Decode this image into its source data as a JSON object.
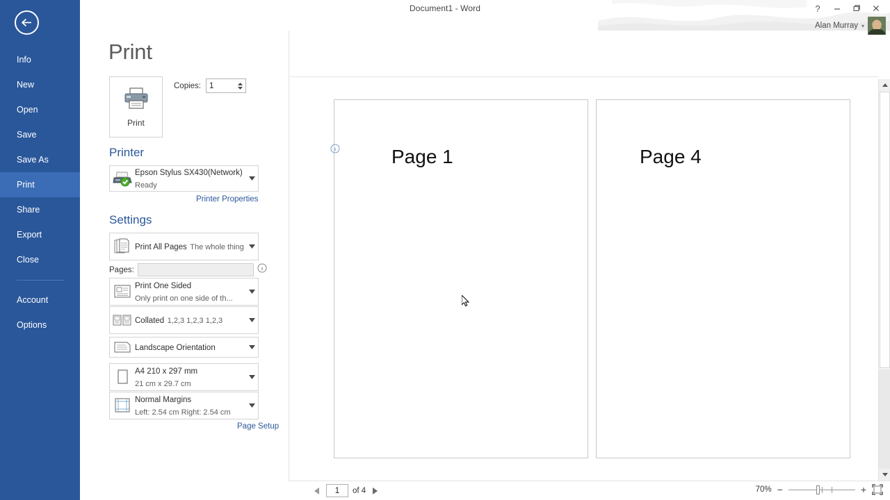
{
  "titlebar": {
    "document_title": "Document1 - Word",
    "help_icon": "question-mark-icon",
    "minimize_icon": "minimize-icon",
    "restore_icon": "restore-window-icon",
    "close_icon": "close-icon",
    "account_name": "Alan Murray",
    "account_caret": "▾"
  },
  "sidebar": {
    "back_icon": "back-arrow-icon",
    "items": [
      {
        "label": "Info",
        "name": "info",
        "active": false
      },
      {
        "label": "New",
        "name": "new",
        "active": false
      },
      {
        "label": "Open",
        "name": "open",
        "active": false
      },
      {
        "label": "Save",
        "name": "save",
        "active": false
      },
      {
        "label": "Save As",
        "name": "save-as",
        "active": false
      },
      {
        "label": "Print",
        "name": "print",
        "active": true
      },
      {
        "label": "Share",
        "name": "share",
        "active": false
      },
      {
        "label": "Export",
        "name": "export",
        "active": false
      },
      {
        "label": "Close",
        "name": "close",
        "active": false
      }
    ],
    "footer_items": [
      {
        "label": "Account",
        "name": "account"
      },
      {
        "label": "Options",
        "name": "options"
      }
    ]
  },
  "print_panel": {
    "heading": "Print",
    "print_button_label": "Print",
    "print_button_icon": "printer-icon",
    "copies_label": "Copies:",
    "copies_value": "1",
    "printer_section_title": "Printer",
    "printer_info_icon": "info-icon",
    "printer_name": "Epson Stylus SX430(Network)",
    "printer_status": "Ready",
    "printer_icon": "printer-ready-icon",
    "printer_properties_link": "Printer Properties",
    "settings_section_title": "Settings",
    "pages_label": "Pages:",
    "pages_value": "",
    "pages_info_icon": "info-icon",
    "page_setup_link": "Page Setup",
    "settings": [
      {
        "name": "print-range",
        "icon": "stacked-pages-icon",
        "primary": "Print All Pages",
        "secondary": "The whole thing"
      },
      {
        "name": "print-sides",
        "icon": "one-sided-page-icon",
        "primary": "Print One Sided",
        "secondary": "Only print on one side of th..."
      },
      {
        "name": "collation",
        "icon": "collated-pages-icon",
        "primary": "Collated",
        "secondary": "1,2,3   1,2,3   1,2,3"
      },
      {
        "name": "orientation",
        "icon": "landscape-page-icon",
        "primary": "Landscape Orientation",
        "secondary": ""
      },
      {
        "name": "paper-size",
        "icon": "portrait-page-icon",
        "primary": "A4 210 x 297 mm",
        "secondary": "21 cm x 29.7 cm"
      },
      {
        "name": "margins",
        "icon": "margins-grid-icon",
        "primary": "Normal Margins",
        "secondary": "Left:  2.54 cm    Right:  2.54 cm"
      }
    ]
  },
  "preview": {
    "pages": [
      {
        "label": "Page 1"
      },
      {
        "label": "Page 4"
      }
    ]
  },
  "statusbar": {
    "prev_icon": "previous-page-icon",
    "next_icon": "next-page-icon",
    "current_page": "1",
    "page_count_label": "of 4",
    "zoom_level": "70%",
    "zoom_out_icon": "minus-icon",
    "zoom_in_icon": "plus-icon",
    "zoom_fit_icon": "zoom-to-page-icon"
  },
  "colors": {
    "backstage_blue": "#2a579a",
    "nav_active_blue": "#3a6db5",
    "link_blue": "#2a579a",
    "section_title_blue": "#2a579a"
  }
}
